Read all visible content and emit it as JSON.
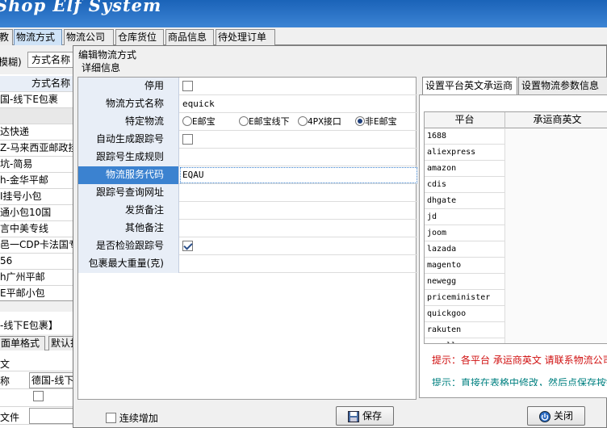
{
  "app": {
    "title_visible": "Shop Elf System"
  },
  "main_tabs": [
    "教",
    "物流方式",
    "物流公司",
    "仓库货位",
    "商品信息",
    "待处理订单"
  ],
  "left_panel": {
    "search_prefix": "模糊)",
    "search_placeholder": "方式名称",
    "column_header": "方式名称",
    "rows": [
      "国-线下E包裹",
      "",
      "达快递",
      "Z-马来西亚邮政挂",
      "坑-简易",
      "h-金华平邮",
      "I挂号小包",
      "通小包10国",
      "言中美专线",
      "邑一CDP卡法国专线",
      "56",
      "h广州平邮",
      "E平邮小包"
    ],
    "section_title": "-线下E包裹】",
    "section_tabs": [
      "面单格式",
      "默认打"
    ],
    "detail_rows": [
      {
        "label": "文",
        "value": ""
      },
      {
        "label": "称",
        "value": "德国-线下E"
      },
      {
        "label": "",
        "value": ""
      },
      {
        "label": "文件",
        "value": ""
      }
    ]
  },
  "dialog": {
    "title": "编辑物流方式",
    "group_label": "详细信息",
    "fields": [
      {
        "label": "停用",
        "type": "checkbox",
        "checked": false
      },
      {
        "label": "物流方式名称",
        "type": "text",
        "value": "equick"
      },
      {
        "label": "特定物流",
        "type": "radio",
        "options": [
          "E邮宝",
          "E邮宝线下",
          "4PX接口",
          "非E邮宝"
        ],
        "selected": "非E邮宝"
      },
      {
        "label": "自动生成跟踪号",
        "type": "checkbox",
        "checked": false
      },
      {
        "label": "跟踪号生成规则",
        "type": "text",
        "value": ""
      },
      {
        "label": "物流服务代码",
        "type": "text",
        "value": "EQAU",
        "selected": true
      },
      {
        "label": "跟踪号查询网址",
        "type": "text",
        "value": ""
      },
      {
        "label": "发货备注",
        "type": "text",
        "value": ""
      },
      {
        "label": "其他备注",
        "type": "text",
        "value": ""
      },
      {
        "label": "是否检验跟踪号",
        "type": "checkbox",
        "checked": true
      },
      {
        "label": "包裹最大重量(克)",
        "type": "text",
        "value": ""
      }
    ],
    "right_tabs": [
      "设置平台英文承运商",
      "设置物流参数信息"
    ],
    "grid": {
      "headers": [
        "平台",
        "承运商英文"
      ],
      "rows": [
        "1688",
        "aliexpress",
        "amazon",
        "cdis",
        "dhgate",
        "jd",
        "joom",
        "lazada",
        "magento",
        "newegg",
        "priceminister",
        "quickgoo",
        "rakuten",
        "rumall"
      ]
    },
    "hint1": "提示：各平台 承运商英文 请联系物流公司",
    "hint2": "提示：直接在表格中修改，然后点保存按钮",
    "continuous_add_label": "连续增加",
    "save_label": "保存",
    "close_label": "关闭"
  },
  "colors": {
    "accent": "#3b82d0",
    "hint_red": "#d01010",
    "hint_teal": "#008080",
    "label_bg": "#e8eef7"
  }
}
